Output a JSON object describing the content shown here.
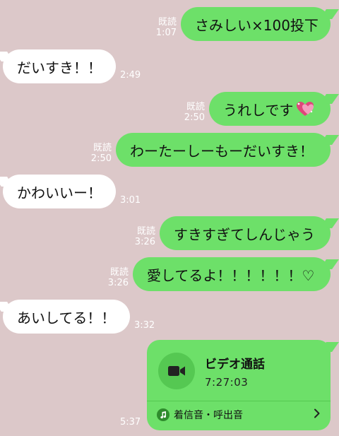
{
  "messages": [
    {
      "dir": "out",
      "text": "さみしい×100投下",
      "read": "既読",
      "time": "1:07"
    },
    {
      "dir": "in",
      "text": "だいすき！！",
      "time": "2:49"
    },
    {
      "dir": "out",
      "text": "うれしです",
      "emoji": "sparkling-heart-icon",
      "read": "既読",
      "time": "2:50"
    },
    {
      "dir": "out",
      "text": "わーたーしーもーだいすき！",
      "read": "既読",
      "time": "2:50"
    },
    {
      "dir": "in",
      "text": "かわいいー！",
      "time": "3:01"
    },
    {
      "dir": "out",
      "text": "すきすぎてしんじゃう",
      "read": "既読",
      "time": "3:26"
    },
    {
      "dir": "out",
      "text": "愛してるよ！！！！！！♡",
      "read": "既読",
      "time": "3:26"
    },
    {
      "dir": "in",
      "text": "あいしてる！！",
      "time": "3:32"
    }
  ],
  "call": {
    "title": "ビデオ通話",
    "duration": "7:27:03",
    "ringtone_label": "着信音・呼出音",
    "time": "5:37"
  },
  "colors": {
    "background": "#dcc8c9",
    "outgoing": "#6de069",
    "incoming": "#ffffff"
  }
}
